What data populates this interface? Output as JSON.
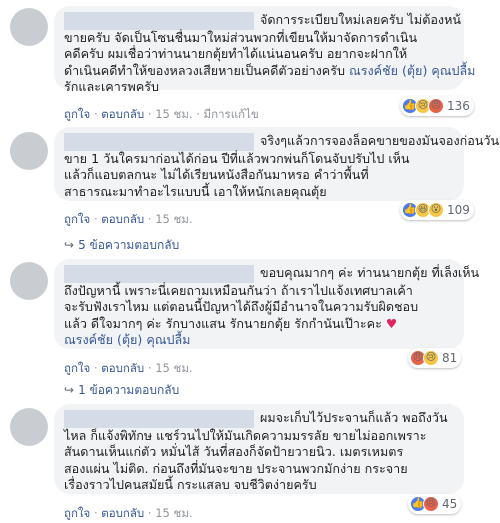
{
  "ui": {
    "like": "ถูกใจ",
    "reply": "ตอบกลับ",
    "dot": "·",
    "edited": "มีการแก้ไข"
  },
  "comments": [
    {
      "lines": [
        "จัดการระเบียบใหม่เลยครับ ไม่ต้องหน้",
        "ขายครับ จัดเป็นโซนชื่นมาใหม่ส่วนพวกที่เขียนให้มาจัดการดำเนิน",
        "คดีครับ ผมเชื่อว่าท่านนายกตุ้ยทำได้แน่นอนครับ อยากจะฝากให้",
        "ดำเนินคดีทำให้ของหลวงเสียหายเป็นคดีตัวอย่างครับ"
      ],
      "mention": "ณรงค์ชัย (ตุ้ย) คุณปลื้ม",
      "tail": "รักและเคารพครับ",
      "time": "15 ชม.",
      "reaction_count": "136",
      "reactions": [
        "like-icon",
        "sad-icon",
        "angry-icon"
      ]
    },
    {
      "lines": [
        "จริงๆแล้วการจองล็อคขายของมันจองก่อนวัน",
        "ขาย 1 วันใครมาก่อนได้ก่อน ปีที่แล้วพวกพ่นก็โดนจับปรับไป เห็น",
        "แล้วก็แอบตลกนะ ไม่ได้เรียนหนังสือกันมาหรอ คำว่าพื้นที่",
        "สาธารณะมาทำอะไรแบบนี้ เอาให้หนักเลยคุณตุ้ย"
      ],
      "time": "15 ชม.",
      "reaction_count": "109",
      "reactions": [
        "like-icon",
        "haha-icon",
        "wow-icon"
      ],
      "replies_label": "5 ข้อความตอบกลับ"
    },
    {
      "lines": [
        "ขอบคุณมากๆ ค่ะ ท่านนายกตุ้ย ที่เล็งเห็น",
        "ถึงปัญหานี้ เพราะนี่เคยถามเหมือนกันว่า ถ้าเราไปแจ้งเทศบาลเค้า",
        "จะรับฟังเราไหม แต่ตอนนี้ปัญหาได้ถึงผู้มีอำนาจในความรับผิดชอบ",
        "แล้ว ดีใจมากๆ ค่ะ รักบางแสน รักนายกตุ้ย รักกำนันเป๊าะคะ"
      ],
      "heart": "♥",
      "mention": "ณรงค์ชัย (ตุ้ย) คุณปลื้ม",
      "time": "15 ชม.",
      "reaction_count": "81",
      "reactions": [
        "angry-icon",
        "sad-icon"
      ],
      "replies_label": "1 ข้อความตอบกลับ"
    },
    {
      "lines": [
        "ผมจะเก็บไว้ประจานก็แล้ว พอถึงวัน",
        "ไหล ก็แจ้งพิทักษ แชร์วนไปให้มันเกิดความมรรลัย ขายไม่ออกเพราะ",
        "สันดานเห็นแก่ตัว หมั่นไส้ วันที่สองก็จัดป้ายวายนิว. เมตรเหมตร",
        "สองแผ่น ไม่ติด. ก่อนถึงที่มันจะขาย ประจานพวกมักง่าย กระจาย",
        "เรื่องราวไปคนสมัยนี้ กระแสลบ จบชีวิตง่ายครับ"
      ],
      "time": "15 ชม.",
      "reaction_count": "45",
      "reactions": [
        "like-icon",
        "angry-icon"
      ]
    }
  ]
}
